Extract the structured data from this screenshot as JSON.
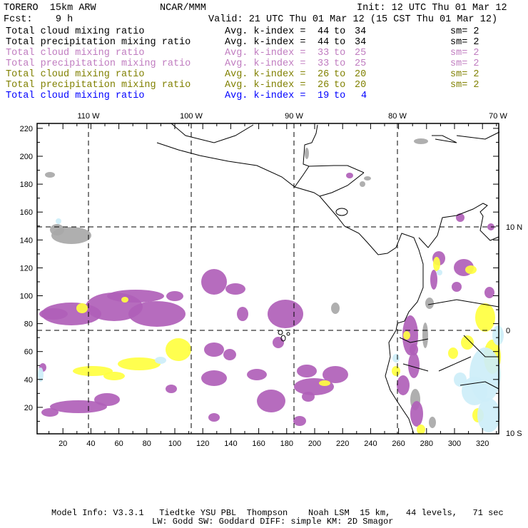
{
  "header": {
    "model": "TORERO  15km ARW",
    "org": "NCAR/MMM",
    "init": "Init: 12 UTC Thu 01 Mar 12",
    "fcst": "Fcst:    9 h",
    "valid": "Valid: 21 UTC Thu 01 Mar 12 (15 CST Thu 01 Mar 12)"
  },
  "legend": [
    {
      "field": "Total cloud mixing ratio",
      "kindex": "Avg. k-index =",
      "from": "44",
      "to_word": "to",
      "to": "34",
      "sm": "sm= 2",
      "color": "#000000"
    },
    {
      "field": "Total precipitation mixing ratio",
      "kindex": "Avg. k-index =",
      "from": "44",
      "to_word": "to",
      "to": "34",
      "sm": "sm= 2",
      "color": "#000000"
    },
    {
      "field": "Total cloud mixing ratio",
      "kindex": "Avg. k-index =",
      "from": "33",
      "to_word": "to",
      "to": "25",
      "sm": "sm= 2",
      "color": "#c07cc0"
    },
    {
      "field": "Total precipitation mixing ratio",
      "kindex": "Avg. k-index =",
      "from": "33",
      "to_word": "to",
      "to": "25",
      "sm": "sm= 2",
      "color": "#c07cc0"
    },
    {
      "field": "Total cloud mixing ratio",
      "kindex": "Avg. k-index =",
      "from": "26",
      "to_word": "to",
      "to": "20",
      "sm": "sm= 2",
      "color": "#808000"
    },
    {
      "field": "Total precipitation mixing ratio",
      "kindex": "Avg. k-index =",
      "from": "26",
      "to_word": "to",
      "to": "20",
      "sm": "sm= 2",
      "color": "#808000"
    },
    {
      "field": "Total cloud mixing ratio",
      "kindex": "Avg. k-index =",
      "from": "19",
      "to_word": "to",
      "to": "4",
      "sm": "",
      "color": "#0000ff"
    }
  ],
  "map": {
    "lon_labels": [
      "110 W",
      "100 W",
      "90 W",
      "80 W",
      "70 W"
    ],
    "lat_labels": [
      "10 N",
      "0",
      "10 S"
    ],
    "x_ticks": [
      "20",
      "40",
      "60",
      "80",
      "100",
      "120",
      "140",
      "160",
      "180",
      "200",
      "220",
      "240",
      "260",
      "280",
      "300",
      "320"
    ],
    "y_ticks": [
      "20",
      "40",
      "60",
      "80",
      "100",
      "120",
      "140",
      "160",
      "180",
      "200",
      "220"
    ],
    "colors": {
      "purple": "#b060b8",
      "gray": "#a8a8a8",
      "yellow": "#ffff40",
      "lightblue": "#cdeef8"
    }
  },
  "footer": {
    "line1": "Model Info: V3.3.1   Tiedtke YSU PBL  Thompson    Noah LSM  15 km,   44 levels,   71 sec",
    "line2": "LW: Godd SW: Goddard DIFF: simple KM: 2D Smagor"
  }
}
